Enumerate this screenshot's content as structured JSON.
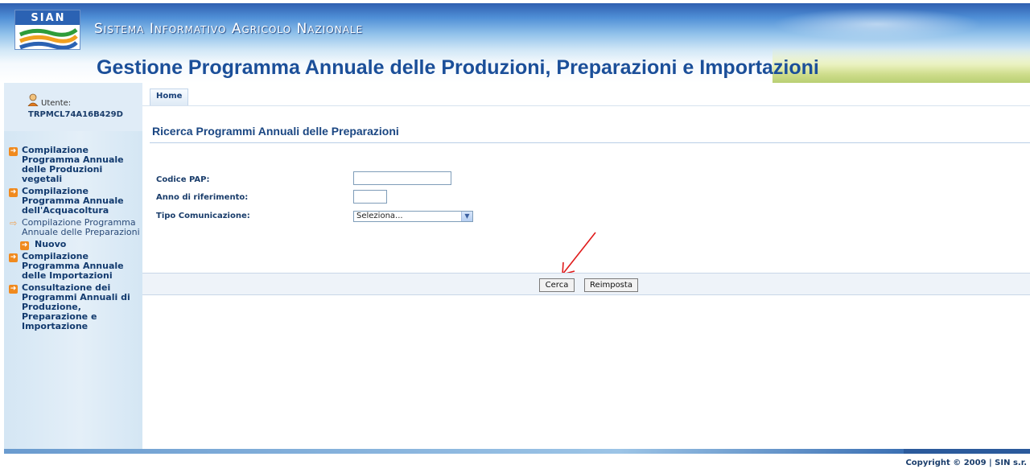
{
  "header": {
    "logo_text": "SIAN",
    "system_name": "Sistema Informativo Agricolo Nazionale",
    "app_title": "Gestione Programma Annuale delle Produzioni, Preparazioni e Importazioni"
  },
  "user": {
    "label": "Utente:",
    "code": "TRPMCL74A16B429D"
  },
  "sidebar": {
    "items": [
      {
        "label": "Compilazione Programma Annuale delle Produzioni vegetali"
      },
      {
        "label": "Compilazione Programma Annuale dell'Acquacoltura"
      },
      {
        "label": "Compilazione Programma Annuale delle Preparazioni"
      },
      {
        "label": "Nuovo"
      },
      {
        "label": "Compilazione Programma Annuale delle Importazioni"
      },
      {
        "label": "Consultazione dei Programmi Annuali di Produzione, Preparazione e Importazione"
      }
    ]
  },
  "tabs": {
    "home": "Home"
  },
  "page": {
    "title": "Ricerca Programmi Annuali delle Preparazioni"
  },
  "form": {
    "codice_label": "Codice PAP:",
    "codice_value": "",
    "anno_label": "Anno di riferimento:",
    "anno_value": "",
    "tipo_label": "Tipo Comunicazione:",
    "tipo_selected": "Seleziona..."
  },
  "buttons": {
    "search": "Cerca",
    "reset": "Reimposta"
  },
  "footer": {
    "copyright": "Copyright © 2009 | SIN s.r."
  },
  "colors": {
    "brand_blue": "#1b4f99",
    "accent_orange": "#f08a1e",
    "annotation_red": "#e01a1a"
  }
}
